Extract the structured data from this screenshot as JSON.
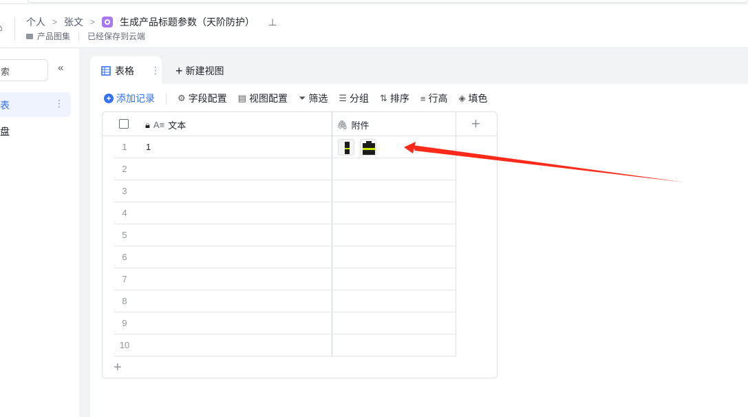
{
  "breadcrumb": {
    "items": [
      "个人",
      "张文"
    ],
    "title": "生成产品标题参数（天阶防护）"
  },
  "subheader": {
    "folder": "产品图集",
    "status": "已经保存到云端"
  },
  "sidebar": {
    "search_placeholder": "索",
    "items": [
      {
        "label": "表"
      },
      {
        "label": "盘"
      }
    ]
  },
  "tabs": {
    "active": "表格",
    "new_view": "新建视图"
  },
  "toolbar": {
    "add_record": "添加记录",
    "field_config": "字段配置",
    "view_config": "视图配置",
    "filter": "筛选",
    "group": "分组",
    "sort": "排序",
    "row_height": "行高",
    "fill": "填色"
  },
  "table": {
    "columns": [
      "文本",
      "附件"
    ],
    "rows": [
      {
        "n": "1",
        "text": "1"
      },
      {
        "n": "2",
        "text": ""
      },
      {
        "n": "3",
        "text": ""
      },
      {
        "n": "4",
        "text": ""
      },
      {
        "n": "5",
        "text": ""
      },
      {
        "n": "6",
        "text": ""
      },
      {
        "n": "7",
        "text": ""
      },
      {
        "n": "8",
        "text": ""
      },
      {
        "n": "9",
        "text": ""
      },
      {
        "n": "10",
        "text": ""
      }
    ]
  },
  "colors": {
    "accent": "#3370ff",
    "arrow": "#ff2a1a",
    "app_icon": "#a978f0"
  }
}
